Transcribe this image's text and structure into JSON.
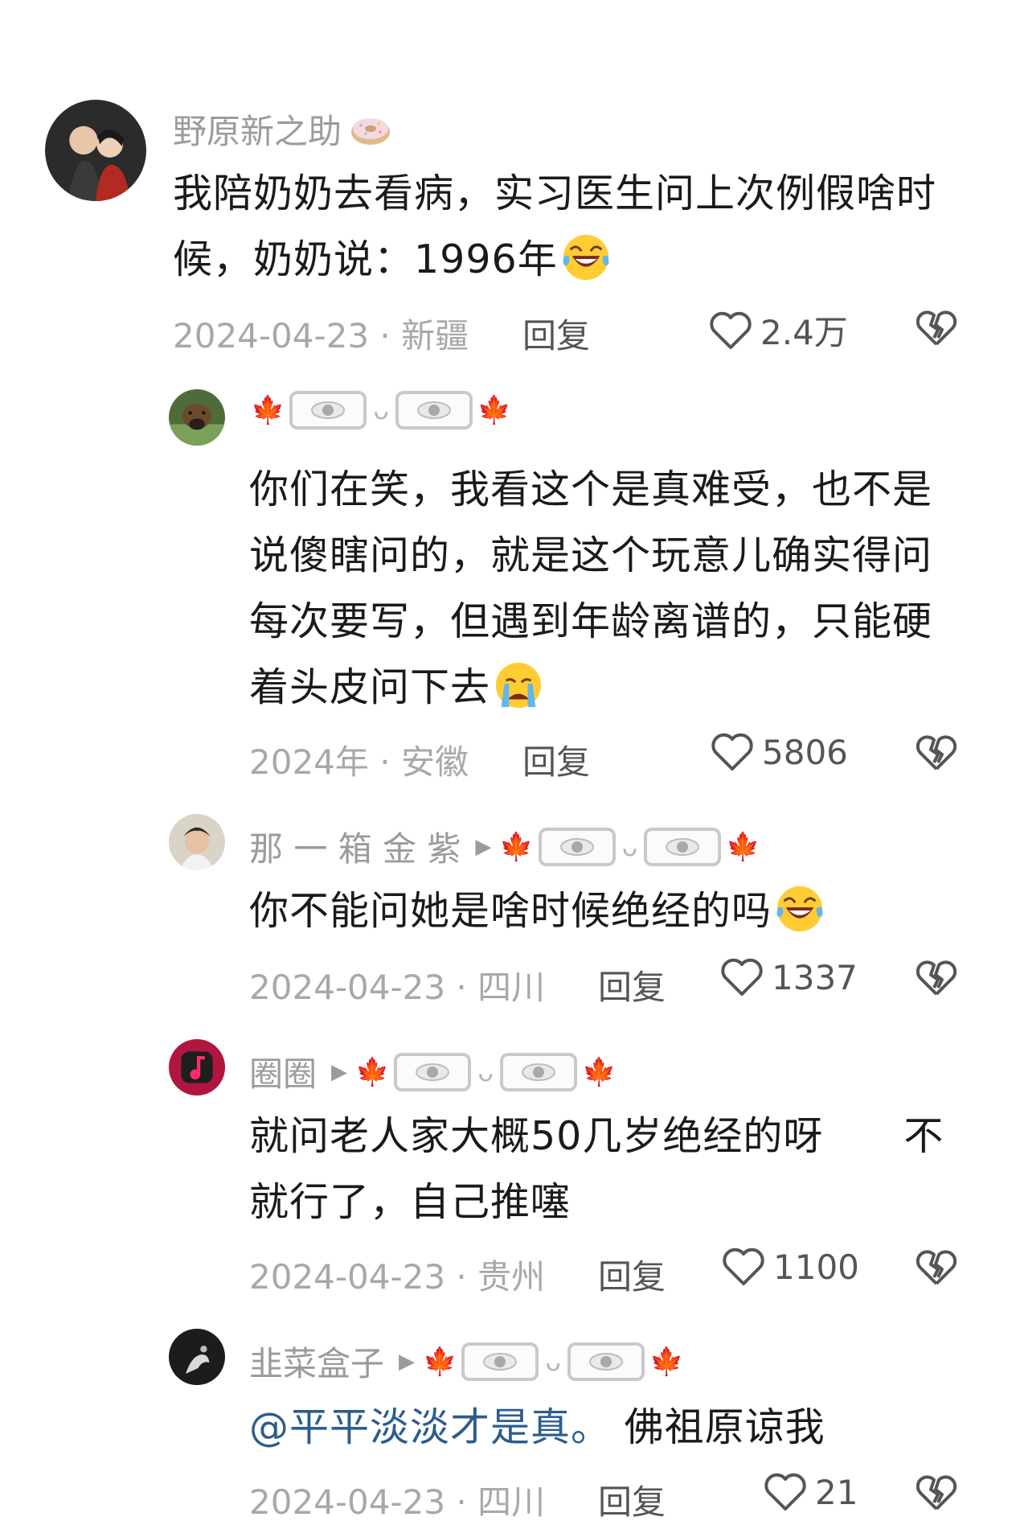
{
  "comments": [
    {
      "user": "野原新之助",
      "text_lines": [
        "我陪奶奶去看病，实习医生问上次例假啥时",
        "候，奶奶说：1996年"
      ],
      "meta": "2024-04-23 · 新疆",
      "reply_label": "回复",
      "likes": "2.4万",
      "badge_icon": "donut-icon",
      "trailing_emoji": "laugh-cry-emoji"
    },
    {
      "user": "",
      "text_lines": [
        "你们在笑，我看这个是真难受，也不是",
        "说傻瞎问的，就是这个玩意儿确实得问",
        "每次要写，但遇到年龄离谱的，只能硬",
        "着头皮问下去"
      ],
      "meta": "2024年 · 安徽",
      "reply_label": "回复",
      "likes": "5806",
      "trailing_emoji": "crying-emoji"
    },
    {
      "user": "那 一 箱 金 紫",
      "text_lines": [
        "你不能问她是啥时候绝经的吗"
      ],
      "meta": "2024-04-23 · 四川",
      "reply_label": "回复",
      "likes": "1337",
      "trailing_emoji": "laugh-cry-emoji"
    },
    {
      "user": "圈圈",
      "text_lines": [
        "就问老人家大概50几岁绝经的呀　　不",
        "就行了，自己推噻"
      ],
      "meta": "2024-04-23 · 贵州",
      "reply_label": "回复",
      "likes": "1100"
    },
    {
      "user": "韭菜盒子",
      "mention": "@平平淡淡才是真。",
      "text_after_mention": " 佛祖原谅我",
      "meta": "2024-04-23 · 四川",
      "reply_label": "回复",
      "likes": "21"
    }
  ],
  "colors": {
    "muted": "#9b9b9b",
    "mention": "#2c5d8c",
    "text": "#1a1a1a"
  }
}
